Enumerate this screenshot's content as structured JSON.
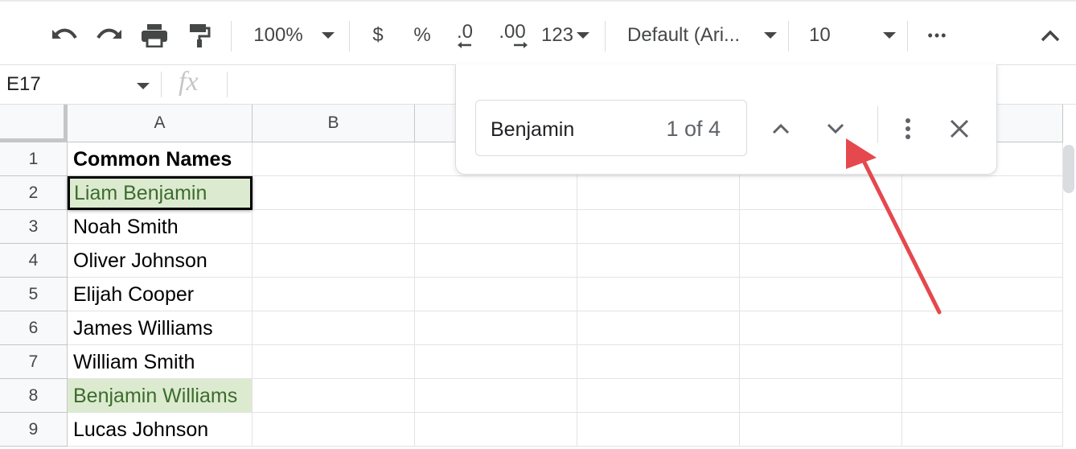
{
  "toolbar": {
    "zoom": "100%",
    "currency": "$",
    "percent": "%",
    "decrease_decimal": ".0",
    "increase_decimal": ".00",
    "more_formats": "123",
    "font": "Default (Ari...",
    "font_size": "10",
    "more": "•••",
    "icons": [
      "undo-icon",
      "redo-icon",
      "print-icon",
      "paint-format-icon",
      "collapse-icon"
    ]
  },
  "formula_bar": {
    "name_box": "E17",
    "fx_label": "fx"
  },
  "sheet": {
    "columns": [
      "A",
      "B"
    ],
    "rows": [
      {
        "num": "1",
        "a": "Common Names"
      },
      {
        "num": "2",
        "a": "Liam Benjamin"
      },
      {
        "num": "3",
        "a": "Noah Smith"
      },
      {
        "num": "4",
        "a": "Oliver Johnson"
      },
      {
        "num": "5",
        "a": "Elijah Cooper"
      },
      {
        "num": "6",
        "a": "James Williams"
      },
      {
        "num": "7",
        "a": "William Smith"
      },
      {
        "num": "8",
        "a": "Benjamin Williams"
      },
      {
        "num": "9",
        "a": "Lucas Johnson"
      }
    ],
    "highlight_color": "#dcebd0"
  },
  "find": {
    "query": "Benjamin",
    "count": "1 of 4"
  },
  "annotation_color": "#e5484d"
}
